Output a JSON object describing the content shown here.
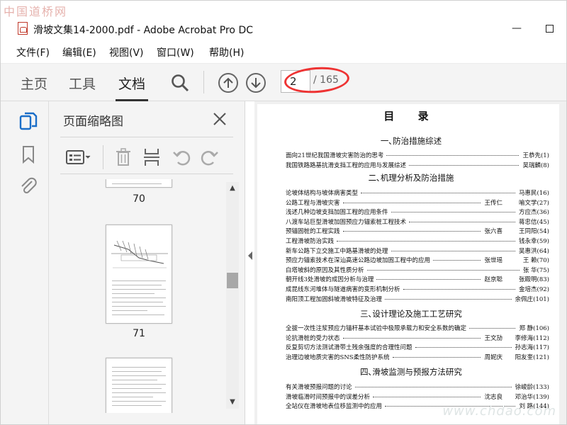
{
  "watermark": {
    "top_left": "中国道桥网",
    "bottom_right": "www.chdao.com"
  },
  "window": {
    "title": "滑坡文集14-2000.pdf - Adobe Acrobat Pro DC"
  },
  "menu": [
    "文件(F)",
    "编辑(E)",
    "视图(V)",
    "窗口(W)",
    "帮助(H)"
  ],
  "toolbar": {
    "tabs": [
      "主页",
      "工具",
      "文档"
    ],
    "active_tab": "文档",
    "page_current": "2",
    "page_total": "/ 165"
  },
  "panel": {
    "title": "页面缩略图",
    "thumbnails": [
      {
        "label": "70"
      },
      {
        "label": "71"
      }
    ]
  },
  "document": {
    "heading": "目 录",
    "sections": [
      {
        "title": "一､防治措施综述",
        "entries": [
          {
            "text": "面向21世纪我国滑坡灾害防治的思考",
            "author": "",
            "ref": "王恭先(1)"
          },
          {
            "text": "我国铁路路基抗滑支挡工程的应用与发展综述",
            "author": "",
            "ref": "吴瑞麟(8)"
          }
        ]
      },
      {
        "title": "二､机理分析及防治措施",
        "entries": [
          {
            "text": "论坡体结构与坡体病害类型",
            "author": "",
            "ref": "马惠民(16)"
          },
          {
            "text": "公路工程与滑坡灾害",
            "author": "王传仁",
            "ref": "喻文学(27)"
          },
          {
            "text": "浅述几种边坡支挡加固工程的应用条件",
            "author": "",
            "ref": "方应杰(36)"
          },
          {
            "text": "八渡车站巨型滑坡加固预应力锚索桩工程技术",
            "author": "",
            "ref": "蒋忠信(45)"
          },
          {
            "text": "预锚固桩的工程实践",
            "author": "张六喜",
            "ref": "王同阳(54)"
          },
          {
            "text": "工程滑坡防治实践",
            "author": "",
            "ref": "钱永幸(59)"
          },
          {
            "text": "新车公路下立交施工中路基滑坡的处理",
            "author": "",
            "ref": "吴惠洪(64)"
          },
          {
            "text": "预应力锚索技术在深汕高速公路边坡加固工程中的应用",
            "author": "张世瑶",
            "ref": "王 赖(70)"
          },
          {
            "text": "白塔坡斜的原因及其性质分析",
            "author": "",
            "ref": "张 华(75)"
          },
          {
            "text": "朝开线3处滑坡的成因分析与治理",
            "author": "赵京聪",
            "ref": "张殿明(83)"
          },
          {
            "text": "成昆线东河堆体与隧道病害的变形机制分析",
            "author": "",
            "ref": "金培杰(92)"
          },
          {
            "text": "南阳顶工程加固斜坡滑坡特征及治理",
            "author": "",
            "ref": "余佩庄(101)"
          }
        ]
      },
      {
        "title": "三､设计理论及施工工艺研究",
        "entries": [
          {
            "text": "全拔一次性注浆预应力锚杆基本试验中极限承载力和安全系数的确定",
            "author": "",
            "ref": "郑 静(106)"
          },
          {
            "text": "论抗滑桩的受力状态",
            "author": "王文劢",
            "ref": "李修海(112)"
          },
          {
            "text": "反复剪切方法测试滑带土残余强度的合理性问题",
            "author": "",
            "ref": "孙志海(117)"
          },
          {
            "text": "治理边坡地质灾害的SNS柔性防护系统",
            "author": "周妮庆",
            "ref": "阳友奎(121)"
          }
        ]
      },
      {
        "title": "四､滑坡监测与预报方法研究",
        "entries": [
          {
            "text": "有关滑坡预报问题的讨论",
            "author": "",
            "ref": "徐峻龄(133)"
          },
          {
            "text": "滑坡临滑时间预报中的误差分析",
            "author": "沈志良",
            "ref": "邓治华(139)"
          },
          {
            "text": "全站仪在滑坡地表位移监测中的应用",
            "author": "",
            "ref": "刘 路(144)"
          }
        ]
      }
    ]
  }
}
